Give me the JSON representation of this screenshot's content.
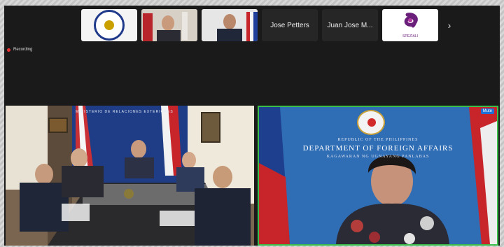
{
  "gallery": {
    "participants": [
      {
        "name": "",
        "kind": "seal"
      },
      {
        "name": "",
        "kind": "video"
      },
      {
        "name": "",
        "kind": "video"
      },
      {
        "name": "Jose Petters",
        "kind": "name"
      },
      {
        "name": "Juan Jose M...",
        "kind": "name"
      },
      {
        "name": "",
        "kind": "logo"
      }
    ],
    "logo_text": "SPEZIALI",
    "next_arrow": "›"
  },
  "recording": {
    "label": "Recording"
  },
  "left_video": {
    "ministry_text": "MINISTERIO DE RELACIONES EXTERIORES"
  },
  "right_video": {
    "mute_label": "Mute",
    "line1": "REPUBLIC OF THE PHILIPPINES",
    "line2": "DEPARTMENT OF FOREIGN AFFAIRS",
    "line3": "KAGAWARAN NG UGNAYANG PANLABAS"
  },
  "colors": {
    "app_bg": "#1a1a1a",
    "active_speaker_border": "#3bbf4a",
    "recording_dot": "#e33",
    "dfa_bg": "#2f6db5"
  }
}
